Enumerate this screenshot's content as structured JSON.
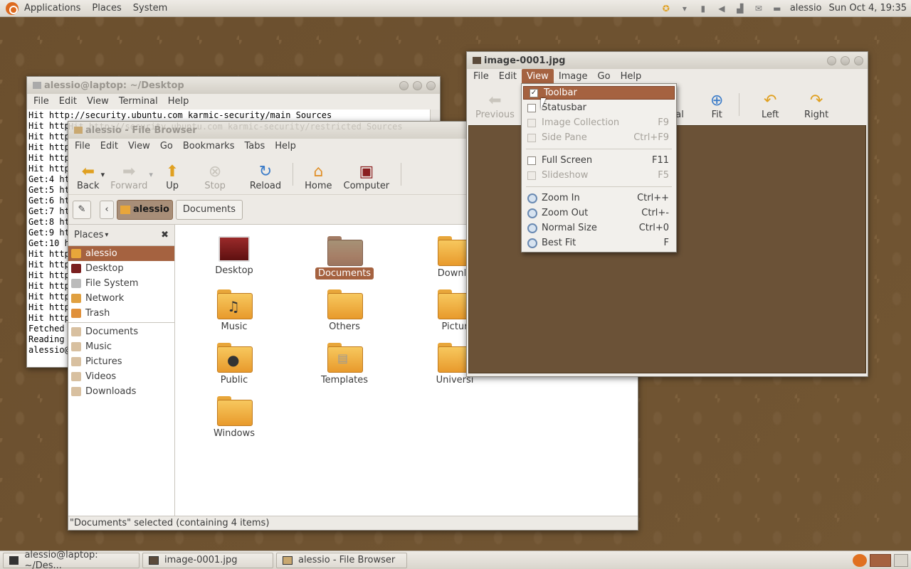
{
  "top_panel": {
    "menus": [
      "Applications",
      "Places",
      "System"
    ],
    "user": "alessio",
    "clock": "Sun Oct  4, 19:35"
  },
  "terminal": {
    "title": "alessio@laptop: ~/Desktop",
    "menus": [
      "File",
      "Edit",
      "View",
      "Terminal",
      "Help"
    ],
    "lines": [
      "Hit http://security.ubuntu.com karmic-security/main Sources",
      "Hit http",
      "Hit http",
      "Hit http",
      "Hit http",
      "Hit http",
      "Get:4 ht",
      "Get:5 ht",
      "Get:6 ht",
      "Get:7 ht",
      "Get:8 ht",
      "Get:9 ht",
      "Get:10 h",
      "Hit http",
      "Hit http",
      "Hit http",
      "Hit http",
      "Hit http",
      "Hit http",
      "Hit http",
      "Fetched",
      "Reading",
      "alessio@"
    ],
    "ghost_line": "Hit http://security.ubuntu.com karmic-security/restricted Sources"
  },
  "file_browser": {
    "title": "alessio - File Browser",
    "menus": [
      "File",
      "Edit",
      "View",
      "Go",
      "Bookmarks",
      "Tabs",
      "Help"
    ],
    "toolbar": {
      "back": "Back",
      "forward": "Forward",
      "up": "Up",
      "stop": "Stop",
      "reload": "Reload",
      "home": "Home",
      "computer": "Computer"
    },
    "path": {
      "current": "alessio",
      "next": "Documents"
    },
    "sidebar_title": "Places",
    "places": [
      "alessio",
      "Desktop",
      "File System",
      "Network",
      "Trash"
    ],
    "bookmarks": [
      "Documents",
      "Music",
      "Pictures",
      "Videos",
      "Downloads"
    ],
    "files": [
      "Desktop",
      "Documents",
      "Downlo",
      "Music",
      "Others",
      "Pictur",
      "Public",
      "Templates",
      "Universi",
      "Windows"
    ],
    "status": "\"Documents\" selected (containing 4 items)"
  },
  "image_viewer": {
    "title": "image-0001.jpg",
    "menus": [
      "File",
      "Edit",
      "View",
      "Image",
      "Go",
      "Help"
    ],
    "toolbar": {
      "previous": "Previous",
      "normal": "nal",
      "fit": "Fit",
      "left": "Left",
      "right": "Right"
    }
  },
  "view_menu": {
    "items": [
      {
        "label": "Toolbar",
        "accel": "",
        "kind": "check",
        "checked": true,
        "highlighted": true
      },
      {
        "label": "Statusbar",
        "accel": "",
        "kind": "check",
        "checked": false
      },
      {
        "label": "Image Collection",
        "accel": "F9",
        "kind": "check",
        "disabled": true
      },
      {
        "label": "Side Pane",
        "accel": "Ctrl+F9",
        "kind": "check",
        "disabled": true
      },
      {
        "label": "Full Screen",
        "accel": "F11",
        "kind": "check"
      },
      {
        "label": "Slideshow",
        "accel": "F5",
        "kind": "check",
        "disabled": true
      },
      {
        "label": "Zoom In",
        "accel": "Ctrl++",
        "kind": "zoom"
      },
      {
        "label": "Zoom Out",
        "accel": "Ctrl+-",
        "kind": "zoom"
      },
      {
        "label": "Normal Size",
        "accel": "Ctrl+0",
        "kind": "zoom"
      },
      {
        "label": "Best Fit",
        "accel": "F",
        "kind": "zoom"
      }
    ]
  },
  "taskbar": [
    "alessio@laptop: ~/Des...",
    "image-0001.jpg",
    "alessio - File Browser"
  ]
}
